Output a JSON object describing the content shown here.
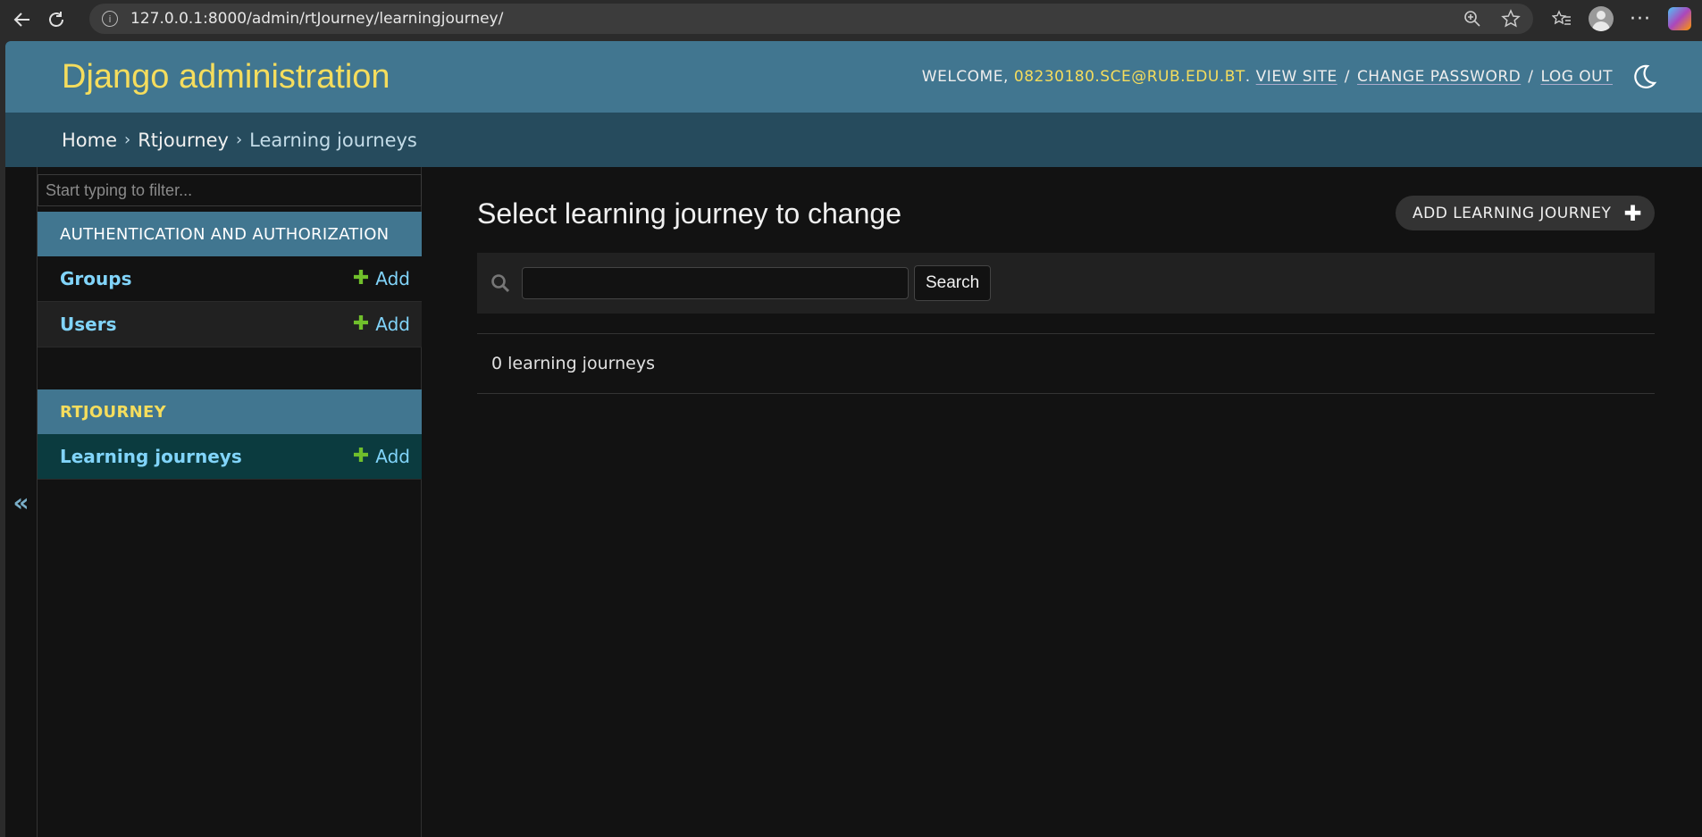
{
  "browser": {
    "url": "127.0.0.1:8000/admin/rtJourney/learningjourney/",
    "icons": [
      "back-icon",
      "reload-icon",
      "info-icon",
      "zoom-icon",
      "star-icon",
      "favorites-icon",
      "profile-icon",
      "more-icon",
      "copilot-icon"
    ]
  },
  "header": {
    "site_name": "Django administration",
    "welcome": "WELCOME,",
    "username": "08230180.SCE@RUB.EDU.BT",
    "view_site": "VIEW SITE",
    "change_password": "CHANGE PASSWORD",
    "log_out": "LOG OUT",
    "separator": "/",
    "dot": "."
  },
  "breadcrumbs": {
    "home": "Home",
    "app": "Rtjourney",
    "current": "Learning journeys",
    "sep": "›"
  },
  "sidebar": {
    "toggle": "«",
    "filter_placeholder": "Start typing to filter...",
    "modules": [
      {
        "caption": "AUTHENTICATION AND AUTHORIZATION",
        "models": [
          {
            "name": "Groups",
            "add": "Add"
          },
          {
            "name": "Users",
            "add": "Add"
          }
        ]
      },
      {
        "caption": "RTJOURNEY",
        "models": [
          {
            "name": "Learning journeys",
            "add": "Add"
          }
        ]
      }
    ]
  },
  "content": {
    "title": "Select learning journey to change",
    "add_button": "ADD LEARNING JOURNEY",
    "search_button": "Search",
    "result_count": "0 learning journeys"
  },
  "colors": {
    "header_bg": "#417690",
    "breadcrumb_bg": "#264b5d",
    "brand_yellow": "#f5dd5d",
    "link_blue": "#81d4fa",
    "add_green": "#70bf2b",
    "page_bg": "#121212"
  }
}
